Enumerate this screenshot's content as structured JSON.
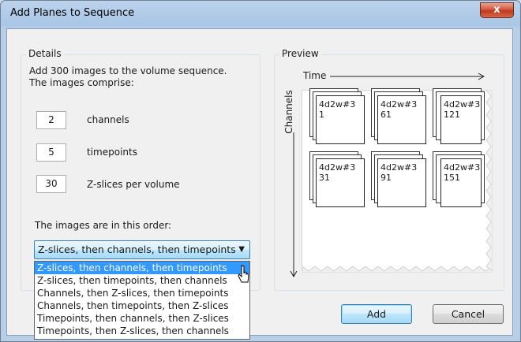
{
  "window": {
    "title": "Add Planes to Sequence",
    "close_label": "x"
  },
  "details": {
    "group_title": "Details",
    "intro_line1": "Add 300 images to the volume sequence.",
    "intro_line2": "The images comprise:",
    "fields": [
      {
        "value": "2",
        "label": "channels"
      },
      {
        "value": "5",
        "label": "timepoints"
      },
      {
        "value": "30",
        "label": "Z-slices per volume"
      }
    ],
    "order_label": "The images are in this order:",
    "order_selected": "Z-slices, then channels, then timepoints",
    "order_options": [
      "Z-slices, then channels, then timepoints",
      "Z-slices, then timepoints, then channels",
      "Channels, then Z-slices, then timepoints",
      "Channels, then timepoints, then Z-slices",
      "Timepoints, then channels, then Z-slices",
      "Timepoints, then Z-slices, then channels"
    ]
  },
  "preview": {
    "group_title": "Preview",
    "time_label": "Time",
    "channels_label": "Channels",
    "cards": [
      {
        "name": "4d2w#3",
        "index": "1"
      },
      {
        "name": "4d2w#3",
        "index": "61"
      },
      {
        "name": "4d2w#3",
        "index": "121"
      },
      {
        "name": "4d2w#3",
        "index": "31"
      },
      {
        "name": "4d2w#3",
        "index": "91"
      },
      {
        "name": "4d2w#3",
        "index": "151"
      }
    ]
  },
  "buttons": {
    "add": "Add",
    "cancel": "Cancel"
  }
}
